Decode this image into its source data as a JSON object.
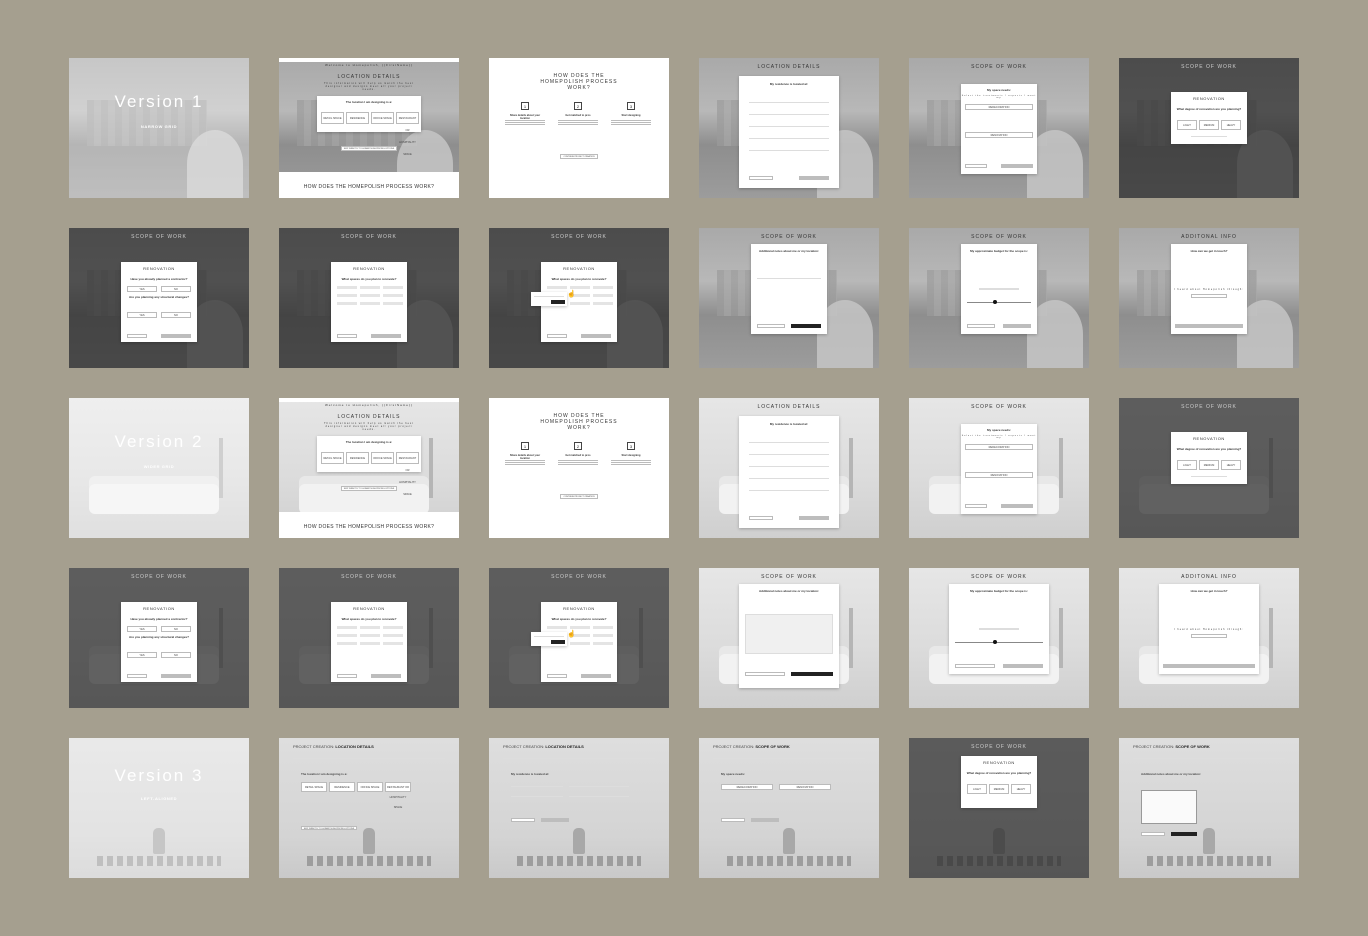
{
  "board": {
    "background": "#a59f8f"
  },
  "versions": [
    {
      "title": "Version 1",
      "subtitle": "NARROW GRID"
    },
    {
      "title": "Version 2",
      "subtitle": "WIDER GRID"
    },
    {
      "title": "Version 3",
      "subtitle": "LEFT-ALIGNED"
    }
  ],
  "screens": {
    "welcome": "Welcome to Homepolish, {{FirstName}}",
    "location_details": "LOCATION DETAILS",
    "location_info": "This information will help us match the best designer and designs meet all your project needs.",
    "location_question": "The location I am designing is a:",
    "location_options": [
      "RETAIL SPACE",
      "RESIDENCE",
      "OFFICE SPACE",
      "RESTAURANT OR HOSPITALITY SPACE"
    ],
    "skip_button": "SKIP DIRECTLY TO HOMEPOLISH PRICING OPTIONS",
    "how_works_title": "HOW DOES THE HOMEPOLISH PROCESS WORK?",
    "how_steps": [
      {
        "num": "1",
        "label": "Share details about your location"
      },
      {
        "num": "2",
        "label": "Get matched to pros"
      },
      {
        "num": "3",
        "label": "Start designing"
      }
    ],
    "continue_button": "CONTINUE PROJECT CREATION",
    "residence_located": "My residence is located at:",
    "scope_of_work": "SCOPE OF WORK",
    "space_needs": "My space needs:",
    "space_needs_sub": "Select the treatments / aspects I want my",
    "need_options": [
      "REDECORATION",
      "RENOVATION"
    ],
    "renovation": "RENOVATION",
    "degree_question": "What degree of renovation are you planning?",
    "degree_options": [
      "LIGHT",
      "MEDIUM",
      "HEAVY"
    ],
    "contractor_question": "Have you already planned a contractor?",
    "structural_question": "Are you planning any structural changes?",
    "yes": "YES",
    "no": "NO",
    "spaces_question": "What spaces do you plan to renovate?",
    "additional_notes": "Additional notes about me or my location:",
    "budget_question": "My approximate budget for the scope is:",
    "additional_info": "ADDITONAL INFO",
    "how_found": "How can we get in touch?",
    "heard_about": "I heard about Homepolish through:",
    "project_creation": "PROJECT CREATION:",
    "back": "BACK",
    "next": "NEXT"
  }
}
